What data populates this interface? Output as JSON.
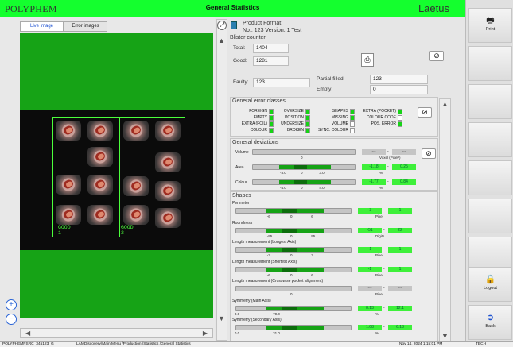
{
  "header": {
    "logo": "POLYPHEM",
    "title": "General Statistics",
    "brand": "Laetus"
  },
  "right_panel": {
    "print": "Print",
    "logout": "Logout",
    "back": "Back"
  },
  "tabs": [
    {
      "label": "Live image"
    },
    {
      "label": "Error images"
    }
  ],
  "image": {
    "good_labels": [
      "GOOD\n1",
      "GOOD\n2"
    ]
  },
  "product": {
    "format_label": "Product Format:",
    "line2": "No.: 123 Version: 1 Test"
  },
  "blister": {
    "title": "Blister counter",
    "total_label": "Total:",
    "total": "1404",
    "good_label": "Good:",
    "good": "1281",
    "faulty_label": "Faulty:",
    "faulty": "123",
    "partial_label": "Partial filled:",
    "partial": "123",
    "empty_label": "Empty:",
    "empty": "0"
  },
  "error_classes": {
    "title": "General error classes",
    "col1": [
      {
        "label": "FOREIGN",
        "state": "green"
      },
      {
        "label": "EMPTY",
        "state": "green"
      },
      {
        "label": "EXTRA (FOIL)",
        "state": "green"
      },
      {
        "label": "COLOUR",
        "state": "green"
      }
    ],
    "col2": [
      {
        "label": "OVERSIZE",
        "state": "green"
      },
      {
        "label": "POSITION",
        "state": "green"
      },
      {
        "label": "UNDERSIZE",
        "state": "green"
      },
      {
        "label": "BROKEN",
        "state": "green"
      }
    ],
    "col3": [
      {
        "label": "SHAPES",
        "state": "green"
      },
      {
        "label": "MISSING",
        "state": "green"
      },
      {
        "label": "VOLUME",
        "state": "white"
      },
      {
        "label": "SYNC. COLOUR",
        "state": "white"
      }
    ],
    "col4": [
      {
        "label": "EXTRA (POCKET)",
        "state": "green"
      },
      {
        "label": "COLOUR CODE",
        "state": "white"
      },
      {
        "label": "POS. ERROR",
        "state": "green"
      }
    ]
  },
  "deviations": {
    "title": "General deviations",
    "rows": [
      {
        "label": "Volume",
        "ticks": [
          "0"
        ],
        "v1": "---",
        "v2": "---",
        "unit": "Voxel (Pixel³)",
        "grey": true
      },
      {
        "label": "Area",
        "ticks": [
          "-3.0",
          "0",
          "3.0"
        ],
        "v1": "-1.18",
        "v2": "0.25",
        "unit": "%",
        "grey": false
      },
      {
        "label": "Colour",
        "ticks": [
          "-4.0",
          "0",
          "4.0"
        ],
        "v1": "-1.77",
        "v2": "0.84",
        "unit": "%",
        "grey": false
      }
    ]
  },
  "shapes": {
    "title": "Shapes",
    "rows": [
      {
        "label": "Perimeter",
        "ticks": [
          "-6",
          "0",
          "6"
        ],
        "v1": "-3",
        "v2": "1",
        "unit": "Pixel",
        "grey": false
      },
      {
        "label": "Roundness",
        "ticks": [
          "-95",
          "0",
          "95"
        ],
        "v1": "-51",
        "v2": "22",
        "unit": "Digits",
        "grey": false
      },
      {
        "label": "Length measurement (Longest Axis)",
        "ticks": [
          "-3",
          "0",
          "3"
        ],
        "v1": "-1",
        "v2": "1",
        "unit": "Pixel",
        "grey": false
      },
      {
        "label": "Length measurement (Shortest Axis)",
        "ticks": [
          "-6",
          "0",
          "6"
        ],
        "v1": "-1",
        "v2": "1",
        "unit": "Pixel",
        "grey": false
      },
      {
        "label": "Length measurement (Crosswise pocket alignment)",
        "ticks": [
          "0"
        ],
        "v1": "---",
        "v2": "---",
        "unit": "Pixel",
        "grey": true
      },
      {
        "label": "Symmetry (Main Axis)",
        "ticks": [
          "0.0",
          "70.0"
        ],
        "v1": "8.13",
        "v2": "12.1",
        "unit": "%",
        "grey": false
      },
      {
        "label": "Symmetry (Secondary Axis)",
        "ticks": [
          "0.0",
          "31.0"
        ],
        "v1": "1.08",
        "v2": "6.13",
        "unit": "%",
        "grey": false
      }
    ]
  },
  "status": {
    "left": "POLYPHEMPSRC_345123_G",
    "path": "LAMDiscovery/Main Menu /Production /Statistics /General Statistics",
    "time": "Nov 14, 2024 1:15:01 PM",
    "user": "TECH"
  }
}
